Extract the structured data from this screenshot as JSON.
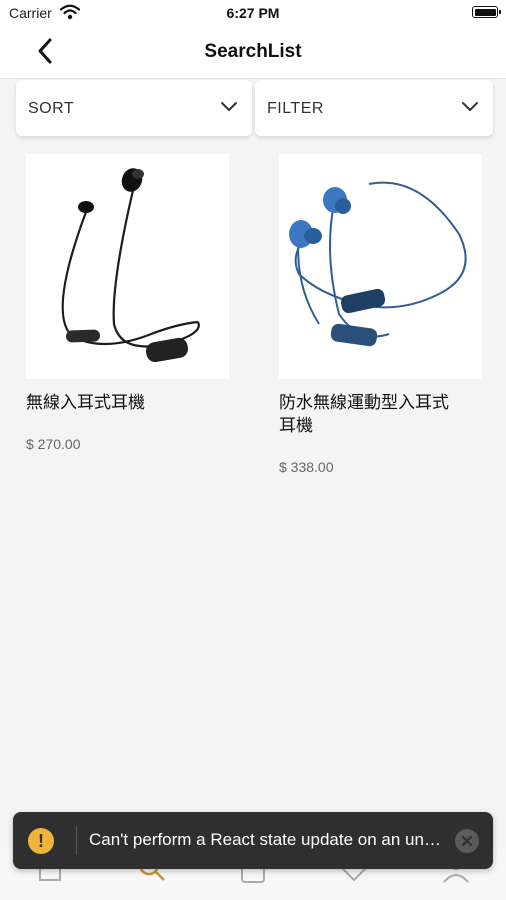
{
  "status_bar": {
    "carrier": "Carrier",
    "time": "6:27 PM"
  },
  "nav": {
    "title": "SearchList",
    "back_icon": "chevron-left-icon"
  },
  "filters": {
    "sort_label": "SORT",
    "filter_label": "FILTER"
  },
  "products": [
    {
      "name": "無線入耳式耳機",
      "price": "$ 270.00",
      "image_color": "#1c1c1c"
    },
    {
      "name": "防水無線運動型入耳式耳機",
      "price": "$ 338.00",
      "image_color": "#3a6fb0"
    }
  ],
  "tab_bar": {
    "tabs": [
      "home-icon",
      "search-icon",
      "bag-icon",
      "heart-icon",
      "profile-icon"
    ],
    "active_color": "#c8962e"
  },
  "toast": {
    "message": "Can't perform a React state update on an unmounted component.",
    "icon": "warning-icon",
    "close_icon": "close-icon"
  },
  "colors": {
    "accent": "#f0b43b",
    "toast_bg": "#2f2f2f"
  }
}
